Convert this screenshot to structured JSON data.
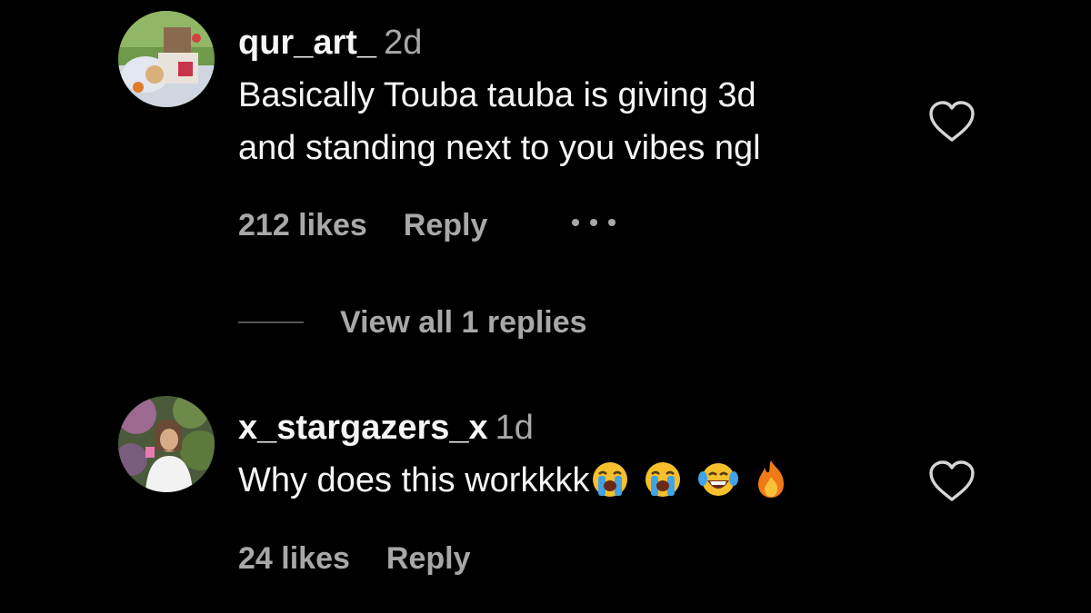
{
  "comments": [
    {
      "username": "qur_art_",
      "time": "2d",
      "text_lines": [
        "Basically Touba tauba is giving 3d",
        "and standing next to you vibes ngl"
      ],
      "likes": "212 likes",
      "reply_label": "Reply",
      "more_icon": "more-options-icon",
      "view_replies": "View all 1 replies"
    },
    {
      "username": "x_stargazers_x",
      "time": "1d",
      "text": "Why does this workkkk",
      "emojis": [
        "loudly-crying-face",
        "loudly-crying-face",
        "tears-of-joy-face",
        "fire"
      ],
      "likes": "24 likes",
      "reply_label": "Reply"
    }
  ],
  "icons": {
    "heart": "heart-outline-icon"
  },
  "colors": {
    "background": "#000000",
    "primary_text": "#f5f5f5",
    "secondary_text": "#a8a8a8"
  }
}
